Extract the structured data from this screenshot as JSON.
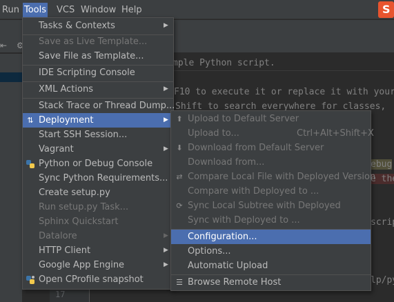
{
  "menubar": {
    "items": [
      {
        "label": "Run"
      },
      {
        "label": "Tools"
      },
      {
        "label": "VCS"
      },
      {
        "label": "Window"
      },
      {
        "label": "Help"
      }
    ]
  },
  "editor": {
    "lines": [
      "mple Python script.",
      "F10 to execute it or replace it with your",
      "Shift to search everywhere for classes,",
      "ebug",
      "e the",
      "scrip",
      "lp/py"
    ],
    "visible_line_number": "17"
  },
  "tools_menu": {
    "items": [
      {
        "label": "Tasks & Contexts",
        "submenu": true
      },
      {
        "label": "Save as Live Template...",
        "disabled": true
      },
      {
        "label": "Save File as Template..."
      },
      {
        "label": "IDE Scripting Console"
      },
      {
        "label": "XML Actions",
        "submenu": true
      },
      {
        "label": "Stack Trace or Thread Dump..."
      },
      {
        "label": "Deployment",
        "submenu": true,
        "selected": true,
        "icon": "deployment-icon"
      },
      {
        "label": "Start SSH Session..."
      },
      {
        "label": "Vagrant",
        "submenu": true
      },
      {
        "label": "Python or Debug Console",
        "icon": "python-icon"
      },
      {
        "label": "Sync Python Requirements..."
      },
      {
        "label": "Create setup.py"
      },
      {
        "label": "Run setup.py Task...",
        "disabled": true
      },
      {
        "label": "Sphinx Quickstart",
        "disabled": true
      },
      {
        "label": "Datalore",
        "submenu": true,
        "disabled": true
      },
      {
        "label": "HTTP Client",
        "submenu": true
      },
      {
        "label": "Google App Engine",
        "submenu": true
      },
      {
        "label": "Open CProfile snapshot",
        "icon": "profiler-icon"
      }
    ]
  },
  "deployment_menu": {
    "items": [
      {
        "label": "Upload to Default Server",
        "disabled": true,
        "icon": "upload-icon"
      },
      {
        "label": "Upload to...",
        "disabled": true,
        "shortcut": "Ctrl+Alt+Shift+X"
      },
      {
        "label": "Download from Default Server",
        "disabled": true,
        "icon": "download-icon"
      },
      {
        "label": "Download from...",
        "disabled": true
      },
      {
        "label": "Compare Local File with Deployed Version",
        "disabled": true,
        "icon": "compare-icon"
      },
      {
        "label": "Compare with Deployed to ...",
        "disabled": true
      },
      {
        "label": "Sync Local Subtree with Deployed",
        "disabled": true,
        "icon": "sync-icon"
      },
      {
        "label": "Sync with Deployed to ...",
        "disabled": true
      },
      {
        "label": "Configuration...",
        "selected": true
      },
      {
        "label": "Options..."
      },
      {
        "label": "Automatic Upload"
      },
      {
        "label": "Browse Remote Host",
        "icon": "remote-host-icon"
      }
    ]
  },
  "colors": {
    "menu_bg": "#3c3f41",
    "selection": "#4b6eaf",
    "editor_bg": "#2b2b2b"
  }
}
